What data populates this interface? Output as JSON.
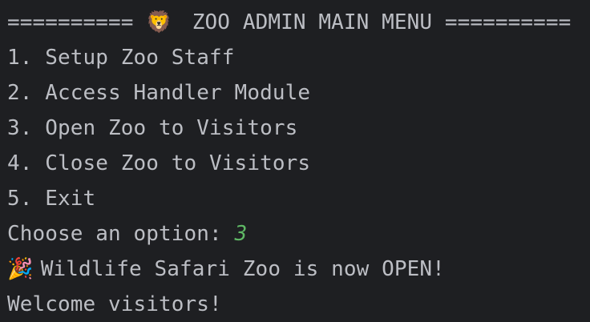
{
  "console": {
    "header": {
      "prefix": "========== ",
      "emoji": "🦁",
      "title": "  ZOO ADMIN MAIN MENU ",
      "suffix": "=========="
    },
    "menu_items": [
      "1. Setup Zoo Staff",
      "2. Access Handler Module",
      "3. Open Zoo to Visitors",
      "4. Close Zoo to Visitors",
      "5. Exit"
    ],
    "prompt": {
      "label": "Choose an option: ",
      "input": "3"
    },
    "status": {
      "emoji": "🎉",
      "message": " Wildlife Safari Zoo is now OPEN!"
    },
    "welcome": "Welcome visitors!"
  },
  "colors": {
    "background": "#1e1f22",
    "text": "#bcbec4",
    "input": "#5fb865"
  }
}
